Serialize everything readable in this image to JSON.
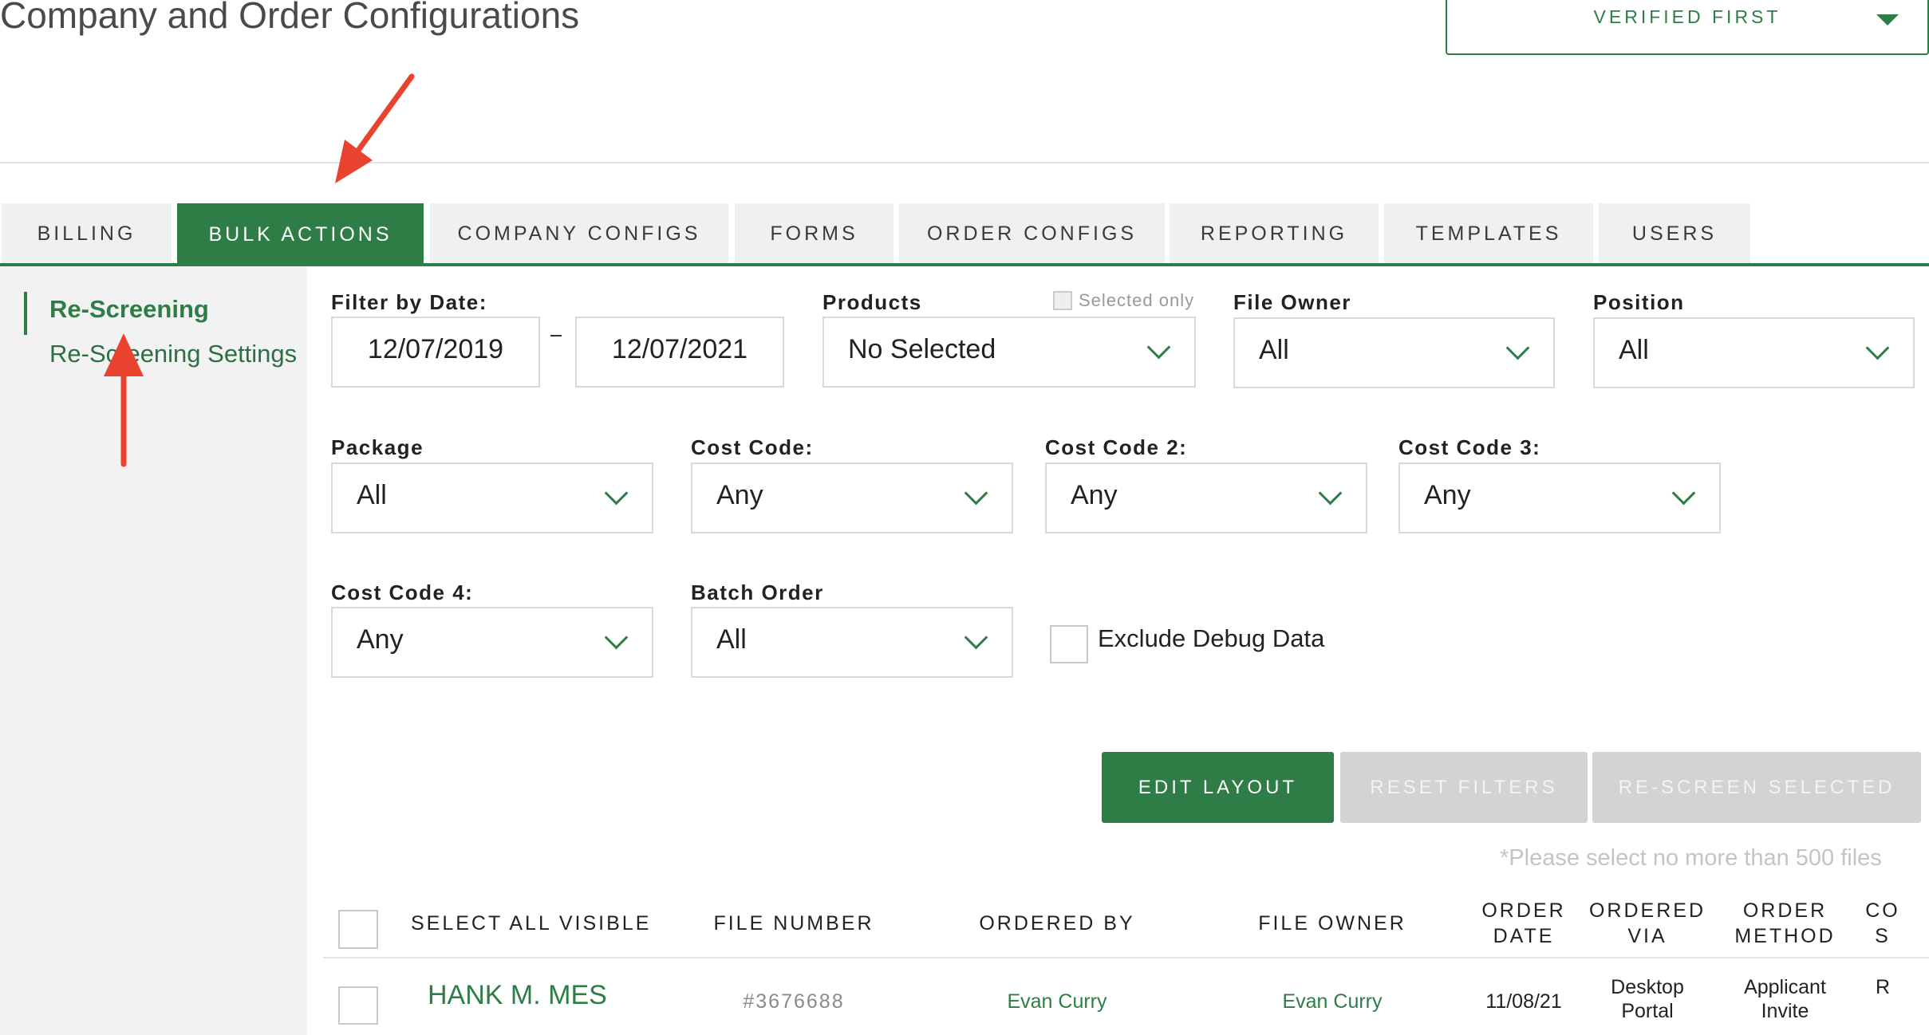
{
  "header": {
    "title": "Company and Order Configurations",
    "company_selector": "VERIFIED FIRST"
  },
  "tabs": [
    {
      "label": "BILLING"
    },
    {
      "label": "BULK ACTIONS",
      "active": true
    },
    {
      "label": "COMPANY CONFIGS"
    },
    {
      "label": "FORMS"
    },
    {
      "label": "ORDER CONFIGS"
    },
    {
      "label": "REPORTING"
    },
    {
      "label": "TEMPLATES"
    },
    {
      "label": "USERS"
    }
  ],
  "sidebar": {
    "items": [
      {
        "label": "Re-Screening",
        "active": true
      },
      {
        "label": "Re-Screening Settings"
      }
    ]
  },
  "filters": {
    "date": {
      "label": "Filter by Date:",
      "from": "12/07/2019",
      "to": "12/07/2021"
    },
    "products": {
      "label": "Products",
      "value": "No Selected",
      "selected_only_label": "Selected only"
    },
    "file_owner": {
      "label": "File Owner",
      "value": "All"
    },
    "position": {
      "label": "Position",
      "value": "All"
    },
    "package": {
      "label": "Package",
      "value": "All"
    },
    "cost_code": {
      "label": "Cost Code:",
      "value": "Any"
    },
    "cost_code_2": {
      "label": "Cost Code 2:",
      "value": "Any"
    },
    "cost_code_3": {
      "label": "Cost Code 3:",
      "value": "Any"
    },
    "cost_code_4": {
      "label": "Cost Code 4:",
      "value": "Any"
    },
    "batch_order": {
      "label": "Batch Order",
      "value": "All"
    },
    "exclude_debug": {
      "label": "Exclude Debug Data",
      "checked": false
    }
  },
  "actions": {
    "edit_layout": "EDIT LAYOUT",
    "reset_filters": "RESET FILTERS",
    "rescreen_selected": "RE-SCREEN SELECTED"
  },
  "note": "*Please select no more than 500 files",
  "table": {
    "headers": {
      "select_all": "SELECT ALL VISIBLE",
      "file_number": "FILE NUMBER",
      "ordered_by": "ORDERED BY",
      "file_owner": "FILE OWNER",
      "order_date_1": "ORDER",
      "order_date_2": "DATE",
      "ordered_via_1": "ORDERED",
      "ordered_via_2": "VIA",
      "order_method_1": "ORDER",
      "order_method_2": "METHOD",
      "co_1": "CO",
      "co_2": "S"
    },
    "rows": [
      {
        "name": "HANK M. MES",
        "file_number": "#3676688",
        "ordered_by": "Evan Curry",
        "file_owner": "Evan Curry",
        "order_date": "11/08/21",
        "ordered_via_1": "Desktop",
        "ordered_via_2": "Portal",
        "order_method_1": "Applicant",
        "order_method_2": "Invite",
        "co": "R"
      }
    ]
  },
  "colors": {
    "accent": "#2e7d47",
    "annotation_arrow": "#e8432e",
    "disabled": "#d3d3d3"
  }
}
